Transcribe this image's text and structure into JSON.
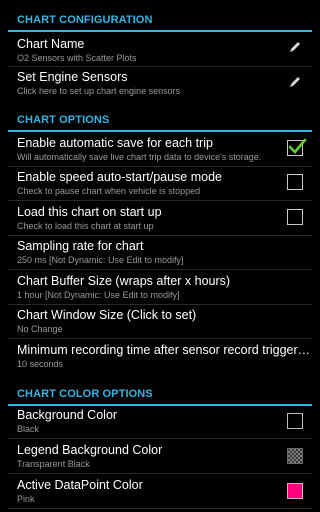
{
  "sections": {
    "configuration": "CHART CONFIGURATION",
    "options": "CHART OPTIONS",
    "color_options": "CHART COLOR OPTIONS"
  },
  "items": {
    "chart_name": {
      "title": "Chart Name",
      "summary": "O2 Sensors with Scatter Plots",
      "icon": "pencil-icon"
    },
    "engine_sensors": {
      "title": "Set Engine Sensors",
      "summary": "Click here to set up chart engine sensors",
      "icon": "pencil-icon"
    },
    "auto_save": {
      "title": "Enable automatic save for each trip",
      "summary": "Will automatically save live chart trip data to device's storage.",
      "checked": true
    },
    "speed_auto": {
      "title": "Enable speed auto-start/pause mode",
      "summary": "Check to pause chart when vehicle is stopped",
      "checked": false
    },
    "load_on_start": {
      "title": "Load this chart on start up",
      "summary": "Check to load this chart at start up",
      "checked": false
    },
    "sampling_rate": {
      "title": "Sampling rate for chart",
      "summary": "250 ms [Not Dynamic: Use Edit to modify]"
    },
    "buffer_size": {
      "title": "Chart Buffer Size (wraps after x hours)",
      "summary": "1 hour [Not Dynamic: Use Edit to modify]"
    },
    "window_size": {
      "title": "Chart Window Size (Click to set)",
      "summary": "No Change"
    },
    "min_recording": {
      "title": "Minimum recording time after sensor record trigger ev..",
      "summary": "10 seconds"
    },
    "background_color": {
      "title": "Background Color",
      "summary": "Black",
      "color": "#000000"
    },
    "legend_background": {
      "title": "Legend Background Color",
      "summary": "Transparent Black",
      "color": "transparent-checker"
    },
    "active_datapoint": {
      "title": "Active DataPoint Color",
      "summary": "Pink",
      "color": "#ff0080"
    }
  },
  "colors": {
    "accent": "#33b5e5",
    "check": "#66cc33"
  }
}
